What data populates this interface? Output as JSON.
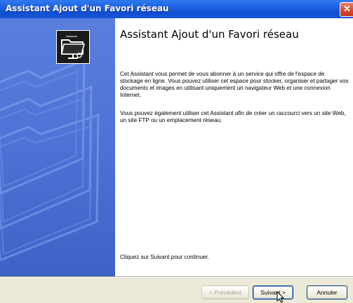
{
  "window": {
    "title": "Assistant Ajout d'un Favori réseau",
    "close_glyph": "✕"
  },
  "content": {
    "heading": "Assistant Ajout d'un Favori réseau",
    "paragraph1": "Cet Assistant vous permet de vous abonner à un service qui offre de l'espace de stockage en ligne. Vous pouvez utiliser cet espace pour stocker, organiser et partager vos documents et images en utilisant uniquement un navigateur Web et une connexion Internet.",
    "paragraph2": "Vous pouvez également utiliser cet Assistant afin de créer un raccourci vers un site Web, un site FTP ou un emplacement réseau.",
    "paragraph3": "Cliquez sur Suivant pour continuer."
  },
  "buttons": {
    "back": "< Précédent",
    "next": "Suivant >",
    "cancel": "Annuler"
  },
  "icons": {
    "wizard": "network-folder-icon",
    "close": "close-icon",
    "cursor": "mouse-cursor-icon"
  },
  "colors": {
    "titlebar": "#1b5fe0",
    "sidebar": "#4d72d6",
    "dialog_bg": "#ece9d8",
    "button_border": "#003c74"
  }
}
